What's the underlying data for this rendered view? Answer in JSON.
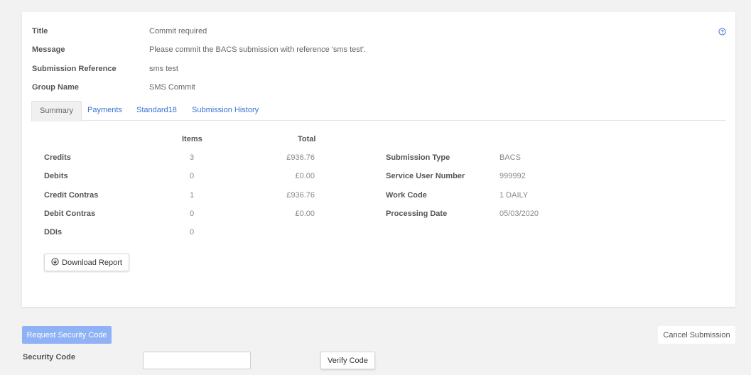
{
  "info": {
    "title_label": "Title",
    "title_value": "Commit required",
    "message_label": "Message",
    "message_value": "Please commit the BACS submission with reference 'sms test'.",
    "reference_label": "Submission Reference",
    "reference_value": "sms test",
    "group_label": "Group Name",
    "group_value": "SMS Commit"
  },
  "tabs": [
    {
      "label": "Summary",
      "active": true
    },
    {
      "label": "Payments",
      "active": false
    },
    {
      "label": "Standard18",
      "active": false
    },
    {
      "label": "Submission History",
      "active": false
    }
  ],
  "summary": {
    "headers": {
      "items": "Items",
      "total": "Total"
    },
    "rows": [
      {
        "label": "Credits",
        "items": "3",
        "total": "£936.76"
      },
      {
        "label": "Debits",
        "items": "0",
        "total": "£0.00"
      },
      {
        "label": "Credit Contras",
        "items": "1",
        "total": "£936.76"
      },
      {
        "label": "Debit Contras",
        "items": "0",
        "total": "£0.00"
      },
      {
        "label": "DDIs",
        "items": "0",
        "total": ""
      }
    ],
    "details": [
      {
        "label": "Submission Type",
        "value": "BACS"
      },
      {
        "label": "Service User Number",
        "value": "999992"
      },
      {
        "label": "Work Code",
        "value": "1 DAILY"
      },
      {
        "label": "Processing Date",
        "value": "05/03/2020"
      }
    ],
    "download_label": "Download Report"
  },
  "actions": {
    "request_label": "Request Security Code",
    "cancel_label": "Cancel Submission",
    "security_label": "Security Code",
    "security_value": "",
    "verify_label": "Verify Code"
  },
  "colors": {
    "accent": "#3b73d5",
    "request_button": "#8fb1f5",
    "background": "#f2f2f2"
  }
}
